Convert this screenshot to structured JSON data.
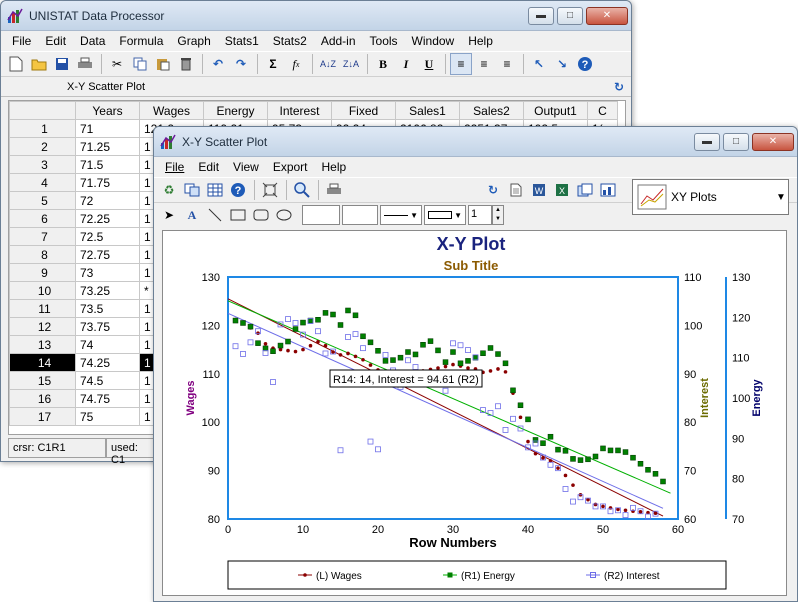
{
  "main_window": {
    "title": "UNISTAT Data Processor",
    "menu": [
      "File",
      "Edit",
      "Data",
      "Formula",
      "Graph",
      "Stats1",
      "Stats2",
      "Add-in",
      "Tools",
      "Window",
      "Help"
    ],
    "sheet_title": "X-Y Scatter Plot",
    "columns": [
      "Years",
      "Wages",
      "Energy",
      "Interest",
      "Fixed",
      "Sales1",
      "Sales2",
      "Output1",
      "C"
    ],
    "rows": [
      {
        "n": "1",
        "years": "71",
        "wages": "121.2",
        "energy": "119.21",
        "interest": "95.73",
        "fixed": "92.24",
        "sales1": "2106.82",
        "sales2": "2251.37",
        "output1": "102.5",
        "c": "1("
      },
      {
        "n": "2",
        "years": "71.25",
        "wages": "1"
      },
      {
        "n": "3",
        "years": "71.5",
        "wages": "1"
      },
      {
        "n": "4",
        "years": "71.75",
        "wages": "1"
      },
      {
        "n": "5",
        "years": "72",
        "wages": "1"
      },
      {
        "n": "6",
        "years": "72.25",
        "wages": "1"
      },
      {
        "n": "7",
        "years": "72.5",
        "wages": "1"
      },
      {
        "n": "8",
        "years": "72.75",
        "wages": "1"
      },
      {
        "n": "9",
        "years": "73",
        "wages": "1"
      },
      {
        "n": "10",
        "years": "73.25",
        "wages": "*"
      },
      {
        "n": "11",
        "years": "73.5",
        "wages": "1"
      },
      {
        "n": "12",
        "years": "73.75",
        "wages": "1"
      },
      {
        "n": "13",
        "years": "74",
        "wages": "1"
      },
      {
        "n": "14",
        "years": "74.25",
        "wages": "1"
      },
      {
        "n": "15",
        "years": "74.5",
        "wages": "1"
      },
      {
        "n": "16",
        "years": "74.75",
        "wages": "1"
      },
      {
        "n": "17",
        "years": "75",
        "wages": "1"
      }
    ],
    "status_cursor": "crsr: C1R1",
    "status_used": "used: C1"
  },
  "plot_window": {
    "title": "X-Y Scatter Plot",
    "menu": [
      "File",
      "Edit",
      "View",
      "Export",
      "Help"
    ],
    "plot_type_selected": "XY Plots",
    "spin_value": "1"
  },
  "colors": {
    "wages": "#8b0000",
    "energy_line": "#00b000",
    "energy_fill": "#008000",
    "interest": "#6e6ee8",
    "title": "#1a237e",
    "subtitle": "#8b5a00",
    "axis": "#1e88e5",
    "wages_label": "#800080",
    "interest_label": "#6b6b00",
    "energy_label": "#00006b"
  },
  "chart_data": {
    "type": "scatter",
    "title": "X-Y Plot",
    "subtitle": "Sub Title",
    "xlabel": "Row Numbers",
    "ylabel_left": "Wages",
    "ylabel_right_inner": "Interest",
    "ylabel_right_outer": "Energy",
    "xlim": [
      0,
      60
    ],
    "ylim_left": [
      80,
      130
    ],
    "ylim_right_inner": [
      60,
      110
    ],
    "ylim_right_outer": [
      70,
      130
    ],
    "x_ticks": [
      "0",
      "10",
      "20",
      "30",
      "40",
      "50",
      "60"
    ],
    "y_ticks_left": [
      "80",
      "90",
      "100",
      "110",
      "120",
      "130"
    ],
    "y_ticks_right_inner": [
      "60",
      "70",
      "80",
      "90",
      "100",
      "110"
    ],
    "y_ticks_right_outer": [
      "70",
      "80",
      "90",
      "100",
      "110",
      "120",
      "130"
    ],
    "grid": true,
    "legend_position": "bottom",
    "tooltip": "R14: 14, Interest = 94.61 (R2)",
    "series": [
      {
        "name": "(L) Wages",
        "axis": "left",
        "marker": "dot",
        "x": [
          1,
          2,
          3,
          4,
          5,
          6,
          7,
          8,
          9,
          10,
          11,
          12,
          13,
          14,
          15,
          16,
          17,
          18,
          19,
          20,
          21,
          22,
          23,
          24,
          25,
          26,
          27,
          28,
          29,
          30,
          31,
          32,
          33,
          34,
          35,
          36,
          37,
          38,
          39,
          40,
          41,
          42,
          43,
          44,
          45,
          46,
          47,
          48,
          49,
          50,
          51,
          52,
          53,
          54,
          55,
          56,
          57
        ],
        "values": [
          121.2,
          120.5,
          119.5,
          118.4,
          116.2,
          115.3,
          115.0,
          114.8,
          114.6,
          115.0,
          115.8,
          116.6,
          115.8,
          114.5,
          113.9,
          114.2,
          113.6,
          112.9,
          111.8,
          110.8,
          110.2,
          109.9,
          109.5,
          110.1,
          110.4,
          110.6,
          110.9,
          111.2,
          111.5,
          111.9,
          111.6,
          111.2,
          111.0,
          110.3,
          110.6,
          111.0,
          110.4,
          106.0,
          101.0,
          96.0,
          93.5,
          92.6,
          92.0,
          90.5,
          89.0,
          87.0,
          85.0,
          84.0,
          83.0,
          82.6,
          82.3,
          82.0,
          81.8,
          81.6,
          81.5,
          81.3,
          81.2
        ],
        "trend": [
          125.5,
          80.6
        ]
      },
      {
        "name": "(R1) Energy",
        "axis": "right_outer",
        "marker": "filled-square",
        "x": [
          1,
          2,
          3,
          4,
          5,
          6,
          7,
          8,
          9,
          10,
          11,
          12,
          13,
          14,
          15,
          16,
          17,
          18,
          19,
          20,
          21,
          22,
          23,
          24,
          25,
          26,
          27,
          28,
          29,
          30,
          31,
          32,
          33,
          34,
          35,
          36,
          37,
          38,
          39,
          40,
          41,
          42,
          43,
          44,
          45,
          46,
          47,
          48,
          49,
          50,
          51,
          52,
          53,
          54,
          55,
          56,
          57,
          58
        ],
        "values": [
          119.2,
          118.6,
          117.7,
          113.6,
          112.3,
          111.6,
          113.0,
          114.0,
          117.1,
          118.7,
          119.2,
          119.4,
          121.1,
          120.7,
          118.1,
          121.7,
          120.5,
          115.3,
          113.8,
          111.7,
          109.2,
          109.4,
          110.0,
          111.4,
          110.8,
          113.2,
          114.1,
          111.8,
          108.9,
          111.4,
          108.6,
          109.2,
          110.0,
          111.1,
          112.4,
          110.9,
          108.6,
          101.9,
          98.2,
          94.7,
          89.6,
          88.8,
          90.4,
          87.2,
          86.9,
          84.9,
          84.6,
          84.8,
          85.5,
          87.5,
          87.0,
          87.0,
          86.6,
          85.2,
          83.7,
          82.2,
          81.2,
          79.3
        ],
        "trend": [
          124.1,
          76.4
        ]
      },
      {
        "name": "(R2) Interest",
        "axis": "right_inner",
        "marker": "open-square",
        "x": [
          1,
          2,
          3,
          4,
          5,
          6,
          7,
          8,
          9,
          10,
          11,
          12,
          13,
          14,
          15,
          16,
          17,
          18,
          19,
          20,
          21,
          22,
          23,
          24,
          25,
          26,
          27,
          28,
          29,
          30,
          31,
          32,
          33,
          34,
          35,
          36,
          37,
          38,
          39,
          40,
          41,
          42,
          43,
          44,
          45,
          46,
          47,
          48,
          49,
          50,
          51,
          52,
          53,
          54,
          55,
          56,
          57
        ],
        "values": [
          95.7,
          94.1,
          96.5,
          98.8,
          94.3,
          88.3,
          100.2,
          101.3,
          100.5,
          98.1,
          100.9,
          98.8,
          94.2,
          94.6,
          74.2,
          97.6,
          98.2,
          95.3,
          76.0,
          74.4,
          93.9,
          90.7,
          87.3,
          92.8,
          91.4,
          89.7,
          88.0,
          88.6,
          86.5,
          96.3,
          95.9,
          94.9,
          93.4,
          82.5,
          81.9,
          83.3,
          78.4,
          80.7,
          78.7,
          74.8,
          75.6,
          72.7,
          71.2,
          70.5,
          66.2,
          63.6,
          64.5,
          63.8,
          62.6,
          62.6,
          61.6,
          61.8,
          60.8,
          62.3,
          61.6,
          60.5,
          61.1
        ],
        "trend": [
          102.5,
          62.2
        ]
      }
    ]
  }
}
